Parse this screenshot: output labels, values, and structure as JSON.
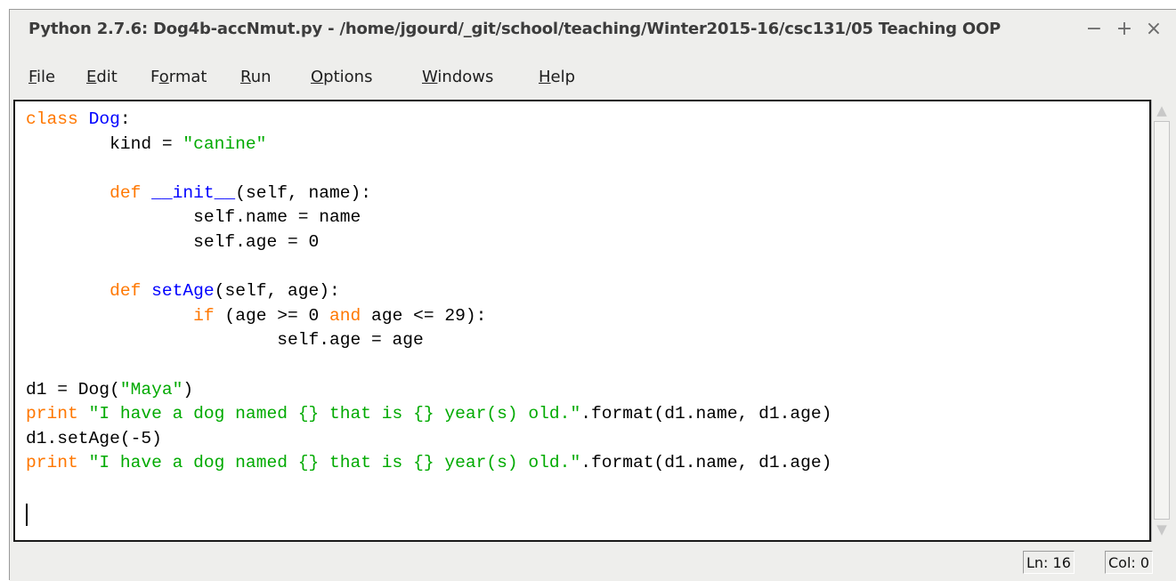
{
  "window": {
    "title": "Python 2.7.6: Dog4b-accNmut.py - /home/jgourd/_git/school/teaching/Winter2015-16/csc131/05 Teaching OOP",
    "controls": {
      "minimize": "−",
      "maximize": "+",
      "close": "×"
    }
  },
  "menu": [
    {
      "label": "File",
      "mnemonic": "F",
      "rest": "ile"
    },
    {
      "label": "Edit",
      "mnemonic": "E",
      "rest": "dit"
    },
    {
      "label": "Format",
      "pre": "F",
      "mnemonic": "o",
      "rest": "rmat"
    },
    {
      "label": "Run",
      "mnemonic": "R",
      "rest": "un"
    },
    {
      "label": "Options",
      "mnemonic": "O",
      "rest": "ptions"
    },
    {
      "label": "Windows",
      "mnemonic": "W",
      "rest": "indows"
    },
    {
      "label": "Help",
      "mnemonic": "H",
      "rest": "elp"
    }
  ],
  "editor": {
    "lines": [
      [
        {
          "t": "kw",
          "v": "class"
        },
        {
          "t": "",
          "v": " "
        },
        {
          "t": "def",
          "v": "Dog"
        },
        {
          "t": "",
          "v": ":"
        }
      ],
      [
        {
          "t": "",
          "v": "        kind = "
        },
        {
          "t": "str",
          "v": "\"canine\""
        }
      ],
      [
        {
          "t": "",
          "v": ""
        }
      ],
      [
        {
          "t": "",
          "v": "        "
        },
        {
          "t": "kw",
          "v": "def"
        },
        {
          "t": "",
          "v": " "
        },
        {
          "t": "def",
          "v": "__init__"
        },
        {
          "t": "",
          "v": "(self, name):"
        }
      ],
      [
        {
          "t": "",
          "v": "                self.name = name"
        }
      ],
      [
        {
          "t": "",
          "v": "                self.age = 0"
        }
      ],
      [
        {
          "t": "",
          "v": ""
        }
      ],
      [
        {
          "t": "",
          "v": "        "
        },
        {
          "t": "kw",
          "v": "def"
        },
        {
          "t": "",
          "v": " "
        },
        {
          "t": "def",
          "v": "setAge"
        },
        {
          "t": "",
          "v": "(self, age):"
        }
      ],
      [
        {
          "t": "",
          "v": "                "
        },
        {
          "t": "kw",
          "v": "if"
        },
        {
          "t": "",
          "v": " (age >= 0 "
        },
        {
          "t": "kw",
          "v": "and"
        },
        {
          "t": "",
          "v": " age <= 29):"
        }
      ],
      [
        {
          "t": "",
          "v": "                        self.age = age"
        }
      ],
      [
        {
          "t": "",
          "v": ""
        }
      ],
      [
        {
          "t": "",
          "v": "d1 = Dog("
        },
        {
          "t": "str",
          "v": "\"Maya\""
        },
        {
          "t": "",
          "v": ")"
        }
      ],
      [
        {
          "t": "kw",
          "v": "print"
        },
        {
          "t": "",
          "v": " "
        },
        {
          "t": "str",
          "v": "\"I have a dog named {} that is {} year(s) old.\""
        },
        {
          "t": "",
          "v": ".format(d1.name, d1.age)"
        }
      ],
      [
        {
          "t": "",
          "v": "d1.setAge(-5)"
        }
      ],
      [
        {
          "t": "kw",
          "v": "print"
        },
        {
          "t": "",
          "v": " "
        },
        {
          "t": "str",
          "v": "\"I have a dog named {} that is {} year(s) old.\""
        },
        {
          "t": "",
          "v": ".format(d1.name, d1.age)"
        }
      ],
      [
        {
          "t": "",
          "v": ""
        }
      ]
    ]
  },
  "scrollbar": {
    "up_arrow": "▲",
    "down_arrow": "▼"
  },
  "status": {
    "line": "Ln: 16",
    "col": "Col: 0"
  },
  "colors": {
    "keyword": "#ff7700",
    "definition": "#0000ff",
    "string": "#00aa00",
    "text": "#000000"
  }
}
